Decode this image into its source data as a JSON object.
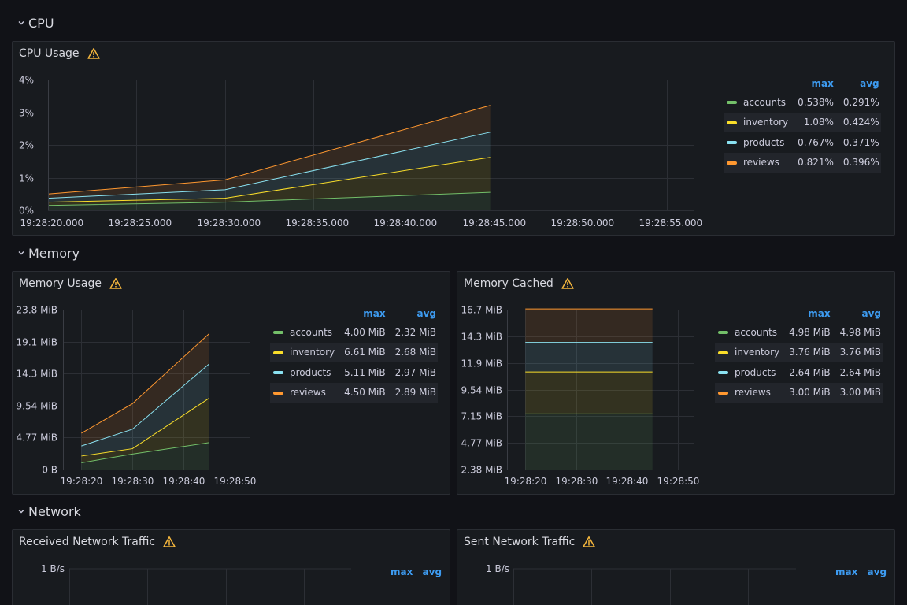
{
  "colors": {
    "accounts": "#73bf69",
    "inventory": "#fade2a",
    "products": "#8ae1f0",
    "reviews": "#ff9830",
    "accent": "#3d9bf0",
    "warning": "#f5b73d"
  },
  "rows": {
    "cpu": "CPU",
    "memory": "Memory",
    "network": "Network"
  },
  "legend_headers": {
    "max": "max",
    "avg": "avg"
  },
  "cpu_usage": {
    "title": "CPU Usage",
    "legend": [
      {
        "name": "accounts",
        "max": "0.538%",
        "avg": "0.291%"
      },
      {
        "name": "inventory",
        "max": "1.08%",
        "avg": "0.424%"
      },
      {
        "name": "products",
        "max": "0.767%",
        "avg": "0.371%"
      },
      {
        "name": "reviews",
        "max": "0.821%",
        "avg": "0.396%"
      }
    ]
  },
  "memory_usage": {
    "title": "Memory Usage",
    "legend": [
      {
        "name": "accounts",
        "max": "4.00 MiB",
        "avg": "2.32 MiB"
      },
      {
        "name": "inventory",
        "max": "6.61 MiB",
        "avg": "2.68 MiB"
      },
      {
        "name": "products",
        "max": "5.11 MiB",
        "avg": "2.97 MiB"
      },
      {
        "name": "reviews",
        "max": "4.50 MiB",
        "avg": "2.89 MiB"
      }
    ]
  },
  "memory_cached": {
    "title": "Memory Cached",
    "legend": [
      {
        "name": "accounts",
        "max": "4.98 MiB",
        "avg": "4.98 MiB"
      },
      {
        "name": "inventory",
        "max": "3.76 MiB",
        "avg": "3.76 MiB"
      },
      {
        "name": "products",
        "max": "2.64 MiB",
        "avg": "2.64 MiB"
      },
      {
        "name": "reviews",
        "max": "3.00 MiB",
        "avg": "3.00 MiB"
      }
    ]
  },
  "received_traffic": {
    "title": "Received Network Traffic",
    "ytick": "1 B/s"
  },
  "sent_traffic": {
    "title": "Sent Network Traffic",
    "ytick": "1 B/s"
  },
  "chart_data": [
    {
      "id": "cpu",
      "type": "area",
      "stacked": true,
      "unit": "%",
      "x": [
        "19:28:20",
        "19:28:30",
        "19:28:45"
      ],
      "xticks": [
        "19:28:20.000",
        "19:28:25.000",
        "19:28:30.000",
        "19:28:35.000",
        "19:28:40.000",
        "19:28:45.000",
        "19:28:50.000",
        "19:28:55.000"
      ],
      "xrange": [
        0,
        36.5
      ],
      "xpos": [
        0,
        10,
        25
      ],
      "ylim": [
        0,
        4
      ],
      "yticks": [
        "0%",
        "1%",
        "2%",
        "3%",
        "4%"
      ],
      "grid": true,
      "legend_position": "right",
      "series": [
        {
          "name": "accounts",
          "values": [
            0.15,
            0.25,
            0.55
          ]
        },
        {
          "name": "inventory",
          "values": [
            0.1,
            0.12,
            1.07
          ]
        },
        {
          "name": "products",
          "values": [
            0.12,
            0.26,
            0.77
          ]
        },
        {
          "name": "reviews",
          "values": [
            0.13,
            0.3,
            0.82
          ]
        }
      ]
    },
    {
      "id": "memory_usage",
      "type": "area",
      "stacked": true,
      "unit": "MiB",
      "x": [
        "19:28:20",
        "19:28:30",
        "19:28:40"
      ],
      "xticks": [
        "19:28:20",
        "19:28:30",
        "19:28:40",
        "19:28:50"
      ],
      "xrange": [
        -3.6,
        33.1
      ],
      "xpos": [
        0,
        10,
        25
      ],
      "ylim": [
        0,
        23.8
      ],
      "yticks": [
        "0 B",
        "4.77 MiB",
        "9.54 MiB",
        "14.3 MiB",
        "19.1 MiB",
        "23.8 MiB"
      ],
      "grid": true,
      "legend_position": "right",
      "series": [
        {
          "name": "accounts",
          "values": [
            1.0,
            2.3,
            4.0
          ]
        },
        {
          "name": "inventory",
          "values": [
            1.0,
            0.8,
            6.6
          ]
        },
        {
          "name": "products",
          "values": [
            1.5,
            2.9,
            5.1
          ]
        },
        {
          "name": "reviews",
          "values": [
            1.9,
            3.8,
            4.5
          ]
        }
      ]
    },
    {
      "id": "memory_cached",
      "type": "area",
      "stacked": true,
      "unit": "MiB",
      "x": [
        "19:28:20",
        "19:28:40"
      ],
      "xticks": [
        "19:28:20",
        "19:28:30",
        "19:28:40",
        "19:28:50"
      ],
      "xrange": [
        -3.6,
        33.1
      ],
      "xpos": [
        0,
        25
      ],
      "ylim": [
        2.38,
        16.7
      ],
      "yticks": [
        "2.38 MiB",
        "4.77 MiB",
        "7.15 MiB",
        "9.54 MiB",
        "11.9 MiB",
        "14.3 MiB",
        "16.7 MiB"
      ],
      "grid": true,
      "legend_position": "right",
      "series": [
        {
          "name": "accounts",
          "values": [
            4.98,
            4.98
          ]
        },
        {
          "name": "inventory",
          "values": [
            3.76,
            3.76
          ]
        },
        {
          "name": "products",
          "values": [
            2.64,
            2.64
          ]
        },
        {
          "name": "reviews",
          "values": [
            3.0,
            3.0
          ]
        }
      ]
    }
  ]
}
